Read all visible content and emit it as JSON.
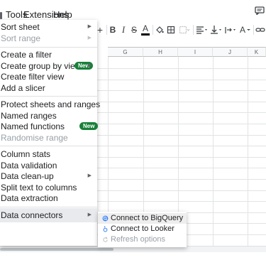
{
  "menubar": {
    "tools": "Tools",
    "extensions": "Extensions",
    "help": "Help"
  },
  "toolbar": {
    "plus": "+",
    "bold": "B",
    "italic": "I",
    "strike": "S",
    "text_color": "A",
    "font_color": "A"
  },
  "grid": {
    "columns": [
      "G",
      "H",
      "I",
      "J",
      "K"
    ]
  },
  "menu": {
    "items": [
      {
        "label": "Sort sheet"
      },
      {
        "label": "Sort range"
      },
      {
        "label": "Create a filter"
      },
      {
        "label": "Create group by view",
        "badge": "New"
      },
      {
        "label": "Create filter view"
      },
      {
        "label": "Add a slicer"
      },
      {
        "label": "Protect sheets and ranges"
      },
      {
        "label": "Named ranges"
      },
      {
        "label": "Named functions",
        "badge": "New"
      },
      {
        "label": "Randomise range"
      },
      {
        "label": "Column stats"
      },
      {
        "label": "Data validation"
      },
      {
        "label": "Data clean-up"
      },
      {
        "label": "Split text to columns"
      },
      {
        "label": "Data extraction"
      },
      {
        "label": "Data connectors"
      }
    ]
  },
  "submenu": {
    "items": [
      {
        "label": "Connect to BigQuery"
      },
      {
        "label": "Connect to Looker"
      },
      {
        "label": "Refresh options"
      }
    ]
  },
  "colors": {
    "badge": "#188038",
    "bigquery": "#4285f4",
    "looker": "#4285f4"
  }
}
